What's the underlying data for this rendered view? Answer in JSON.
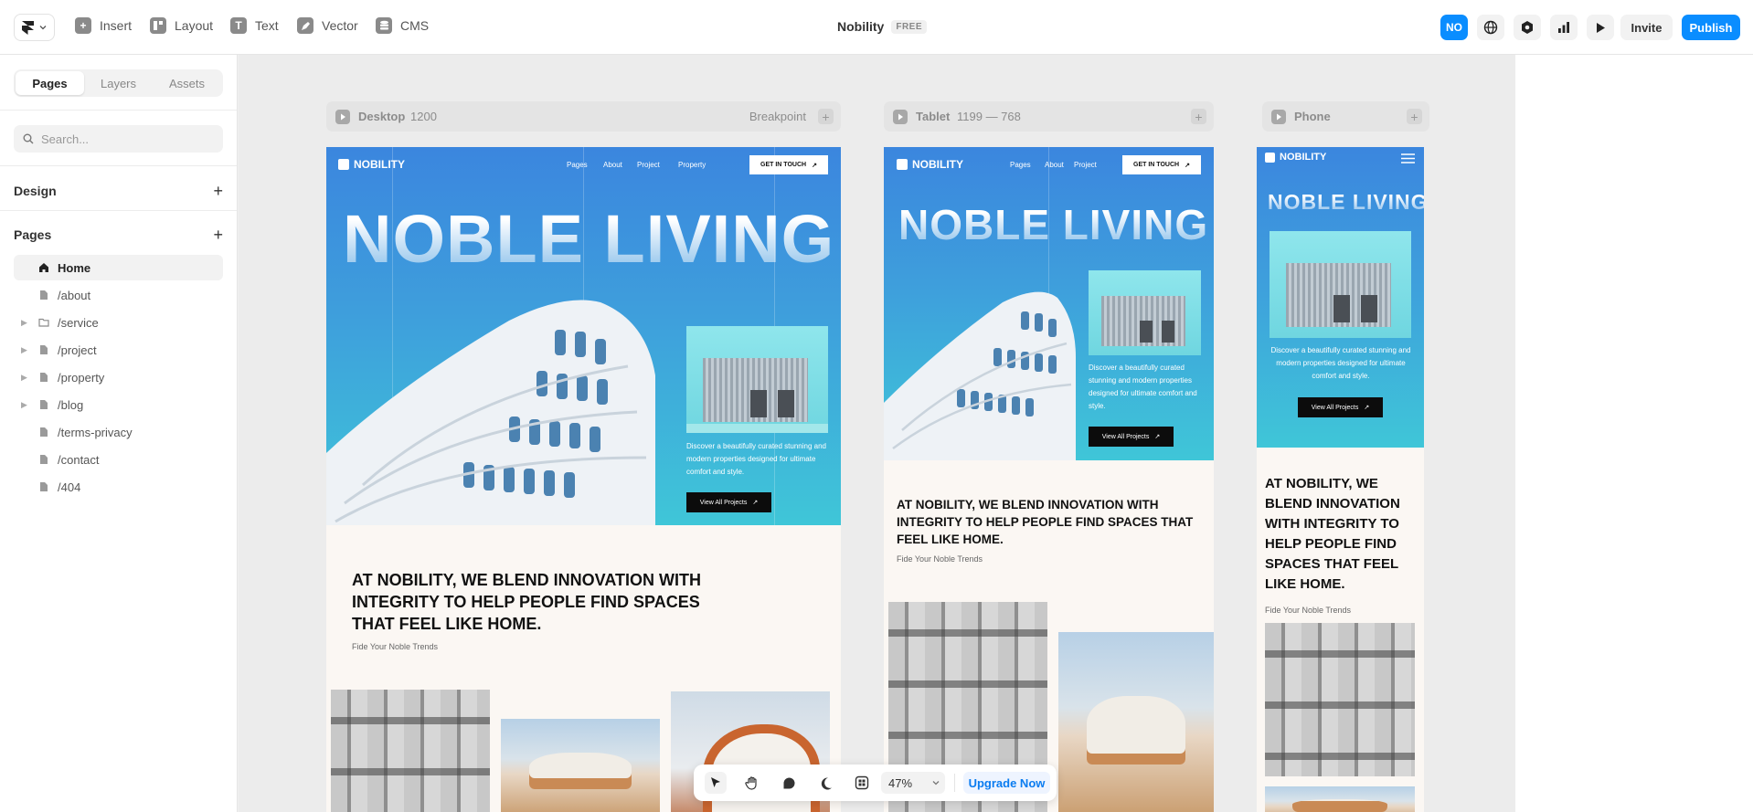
{
  "toolbar": {
    "items": [
      {
        "label": "Insert",
        "icon": "plus-square-icon"
      },
      {
        "label": "Layout",
        "icon": "layout-icon"
      },
      {
        "label": "Text",
        "icon": "text-icon"
      },
      {
        "label": "Vector",
        "icon": "pen-icon"
      },
      {
        "label": "CMS",
        "icon": "database-icon"
      }
    ],
    "project_name": "Nobility",
    "plan_badge": "FREE",
    "avatar_initials": "NO",
    "invite_label": "Invite",
    "publish_label": "Publish"
  },
  "sidebar": {
    "tabs": [
      {
        "label": "Pages",
        "active": true
      },
      {
        "label": "Layers",
        "active": false
      },
      {
        "label": "Assets",
        "active": false
      }
    ],
    "search_placeholder": "Search...",
    "design_heading": "Design",
    "pages_heading": "Pages",
    "pages": [
      {
        "label": "Home",
        "active": true,
        "expandable": false,
        "icon": "home-icon"
      },
      {
        "label": "/about",
        "active": false,
        "expandable": false,
        "icon": "file-icon"
      },
      {
        "label": "/service",
        "active": false,
        "expandable": true,
        "icon": "folder-icon"
      },
      {
        "label": "/project",
        "active": false,
        "expandable": true,
        "icon": "file-icon"
      },
      {
        "label": "/property",
        "active": false,
        "expandable": true,
        "icon": "file-icon"
      },
      {
        "label": "/blog",
        "active": false,
        "expandable": true,
        "icon": "file-icon"
      },
      {
        "label": "/terms-privacy",
        "active": false,
        "expandable": false,
        "icon": "file-icon"
      },
      {
        "label": "/contact",
        "active": false,
        "expandable": false,
        "icon": "file-icon"
      },
      {
        "label": "/404",
        "active": false,
        "expandable": false,
        "icon": "file-icon"
      }
    ]
  },
  "breakpoints": {
    "desktop": {
      "name": "Desktop",
      "size": "1200",
      "label": "Breakpoint"
    },
    "tablet": {
      "name": "Tablet",
      "size": "1199 — 768"
    },
    "phone": {
      "name": "Phone"
    }
  },
  "site": {
    "brand": "NOBILITY",
    "nav": [
      "Pages",
      "About",
      "Project",
      "Property"
    ],
    "cta": "GET IN TOUCH",
    "hero_title": "NOBLE LIVING",
    "hero_text": "Discover a beautifully curated stunning and modern properties designed for ultimate comfort and style.",
    "hero_button": "View All Projects",
    "heading": "AT NOBILITY, WE BLEND INNOVATION WITH INTEGRITY TO HELP PEOPLE FIND SPACES THAT FEEL LIKE HOME.",
    "subheading": "Fide Your Noble Trends"
  },
  "floating_toolbar": {
    "zoom": "47%",
    "upgrade_label": "Upgrade Now"
  },
  "colors": {
    "accent": "#0a8dff",
    "hero_top": "#3b86de",
    "hero_bottom": "#3fc6d8"
  }
}
